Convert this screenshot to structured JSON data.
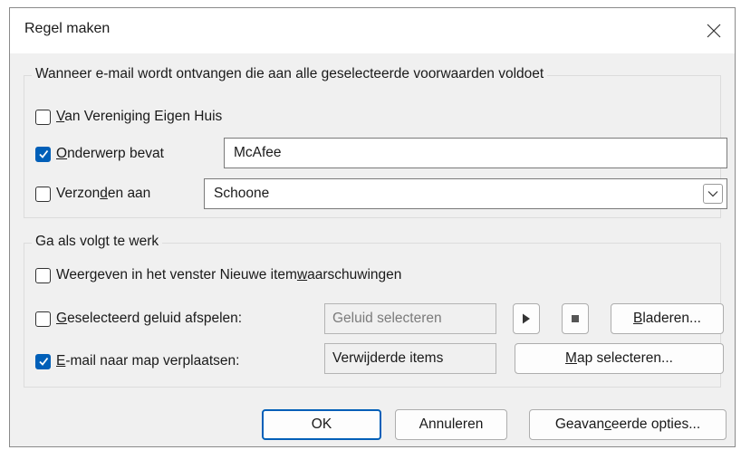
{
  "window": {
    "title": "Regel maken",
    "close_glyph": "✕"
  },
  "conditions": {
    "legend": "Wanneer e-mail wordt ontvangen die aan alle geselecteerde voorwaarden voldoet",
    "from": {
      "checked": false,
      "label_pre": "",
      "label_u": "V",
      "label_post": "an Vereniging Eigen Huis"
    },
    "subject": {
      "checked": true,
      "label_pre": "",
      "label_u": "O",
      "label_post": "nderwerp bevat",
      "value": "McAfee"
    },
    "sent_to": {
      "checked": false,
      "label_pre": "Verzon",
      "label_u": "d",
      "label_post": "en aan",
      "value": "Schoone"
    }
  },
  "actions": {
    "legend": "Ga als volgt te werk",
    "alert": {
      "checked": false,
      "label_pre": "Weergeven in het venster Nieuwe item",
      "label_u": "w",
      "label_post": "aarschuwingen"
    },
    "sound": {
      "checked": false,
      "label_pre": "",
      "label_u": "G",
      "label_post": "eselecteerd geluid afspelen:",
      "value": "Geluid selecteren"
    },
    "browse_button": {
      "label_pre": "",
      "label_u": "B",
      "label_post": "laderen..."
    },
    "move": {
      "checked": true,
      "label_pre": "",
      "label_u": "E",
      "label_post": "-mail naar map verplaatsen:",
      "value": "Verwijderde items"
    },
    "select_folder_button": {
      "label_pre": "",
      "label_u": "M",
      "label_post": "ap selecteren..."
    }
  },
  "footer": {
    "ok": "OK",
    "cancel": "Annuleren",
    "advanced": {
      "label_pre": "Geavan",
      "label_u": "c",
      "label_post": "eerde opties..."
    }
  },
  "colors": {
    "accent": "#005fb8",
    "dialog_bg": "#f0f0f0",
    "titlebar_bg": "#ffffff"
  }
}
